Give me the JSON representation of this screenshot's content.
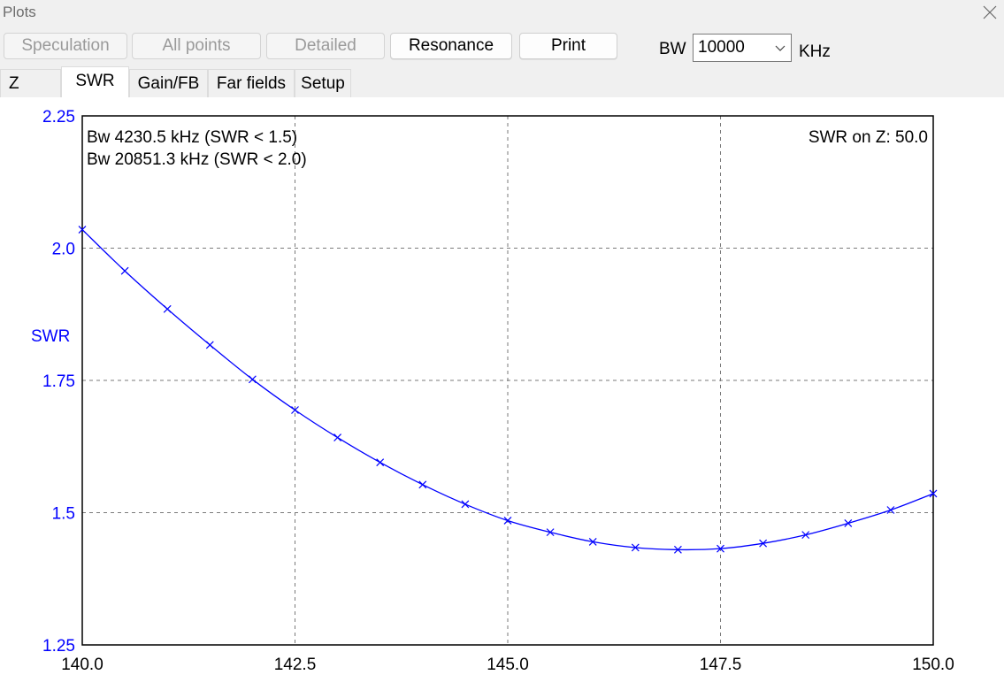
{
  "window": {
    "title": "Plots",
    "close_icon": "close-icon"
  },
  "toolbar": {
    "buttons": [
      {
        "label": "Speculation",
        "enabled": false
      },
      {
        "label": "All points",
        "enabled": false
      },
      {
        "label": "Detailed",
        "enabled": false
      },
      {
        "label": "Resonance",
        "enabled": true
      },
      {
        "label": "Print",
        "enabled": true
      }
    ],
    "bw_label": "BW",
    "bw_value": "10000",
    "bw_unit": "KHz"
  },
  "tabs": [
    {
      "label": "Z",
      "active": false
    },
    {
      "label": "SWR",
      "active": true
    },
    {
      "label": "Gain/FB",
      "active": false
    },
    {
      "label": "Far fields",
      "active": false
    },
    {
      "label": "Setup",
      "active": false
    }
  ],
  "plot": {
    "annotations": {
      "bw1": "Bw 4230.5 kHz (SWR < 1.5)",
      "bw2": "Bw 20851.3 kHz (SWR < 2.0)",
      "z_ref": "SWR on Z: 50.0"
    }
  },
  "chart_data": {
    "type": "line",
    "ylabel": "SWR",
    "xlim": [
      140.0,
      150.0
    ],
    "ylim": [
      1.25,
      2.25
    ],
    "x_ticks": [
      "140.0",
      "142.5",
      "145.0",
      "147.5",
      "150.0"
    ],
    "y_ticks": [
      "1.25",
      "1.5",
      "1.75",
      "2.0",
      "2.25"
    ],
    "grid": true,
    "line_color": "#0000ff",
    "axis_label_color": "#0000ff",
    "series": [
      {
        "x": [
          140.0,
          140.5,
          141.0,
          141.5,
          142.0,
          142.5,
          143.0,
          143.5,
          144.0,
          144.5,
          145.0,
          145.5,
          146.0,
          146.5,
          147.0,
          147.5,
          148.0,
          148.5,
          149.0,
          149.5,
          150.0
        ],
        "y": [
          2.035,
          1.957,
          1.885,
          1.817,
          1.752,
          1.694,
          1.642,
          1.595,
          1.553,
          1.516,
          1.485,
          1.463,
          1.445,
          1.434,
          1.43,
          1.432,
          1.442,
          1.458,
          1.48,
          1.505,
          1.536
        ]
      }
    ]
  }
}
